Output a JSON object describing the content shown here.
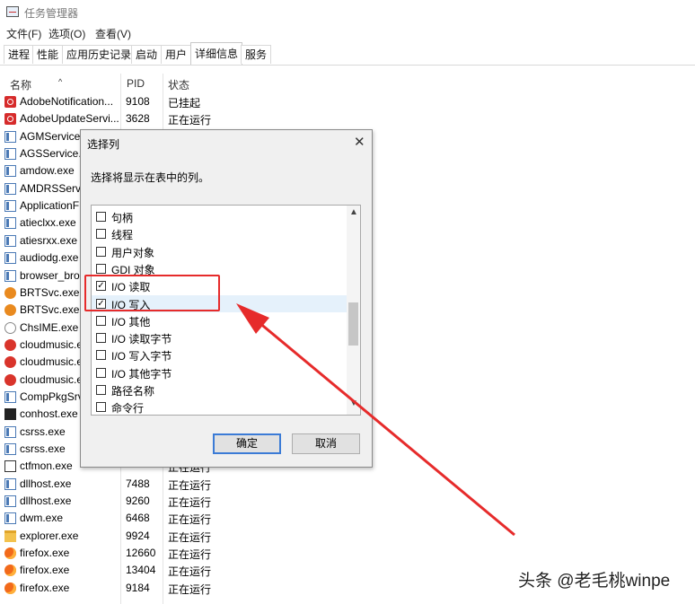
{
  "window": {
    "title": "任务管理器",
    "icon": "task-manager-icon"
  },
  "menu": [
    "文件(F)",
    "选项(O)",
    "查看(V)"
  ],
  "tabs": [
    {
      "label": "进程"
    },
    {
      "label": "性能"
    },
    {
      "label": "应用历史记录"
    },
    {
      "label": "启动"
    },
    {
      "label": "用户"
    },
    {
      "label": "详细信息",
      "active": true
    },
    {
      "label": "服务"
    }
  ],
  "columns": {
    "name": "名称",
    "pid": "PID",
    "status": "状态"
  },
  "rows": [
    {
      "name": "AdobeNotification...",
      "pid": "9108",
      "status": "已挂起",
      "icon": "adobe-icon"
    },
    {
      "name": "AdobeUpdateServi...",
      "pid": "3628",
      "status": "正在运行",
      "icon": "adobe-icon"
    },
    {
      "name": "AGMService",
      "pid": "",
      "status": "",
      "icon": "window-icon"
    },
    {
      "name": "AGSService.e",
      "pid": "",
      "status": "",
      "icon": "window-icon"
    },
    {
      "name": "amdow.exe",
      "pid": "",
      "status": "",
      "icon": "window-icon"
    },
    {
      "name": "AMDRSServ.",
      "pid": "",
      "status": "",
      "icon": "window-icon"
    },
    {
      "name": "ApplicationF",
      "pid": "",
      "status": "",
      "icon": "window-icon"
    },
    {
      "name": "atieclxx.exe",
      "pid": "",
      "status": "",
      "icon": "window-icon"
    },
    {
      "name": "atiesrxx.exe",
      "pid": "",
      "status": "",
      "icon": "window-icon"
    },
    {
      "name": "audiodg.exe",
      "pid": "",
      "status": "",
      "icon": "window-icon"
    },
    {
      "name": "browser_bro",
      "pid": "",
      "status": "",
      "icon": "window-icon"
    },
    {
      "name": "BRTSvc.exe",
      "pid": "",
      "status": "",
      "icon": "gear-icon"
    },
    {
      "name": "BRTSvc.exe",
      "pid": "",
      "status": "",
      "icon": "gear-icon"
    },
    {
      "name": "ChsIME.exe",
      "pid": "",
      "status": "",
      "icon": "ime-icon"
    },
    {
      "name": "cloudmusic.e",
      "pid": "",
      "status": "",
      "icon": "cloudmusic-icon"
    },
    {
      "name": "cloudmusic.e",
      "pid": "",
      "status": "",
      "icon": "cloudmusic-icon"
    },
    {
      "name": "cloudmusic.e",
      "pid": "",
      "status": "",
      "icon": "cloudmusic-icon"
    },
    {
      "name": "CompPkgSrv",
      "pid": "",
      "status": "",
      "icon": "window-icon"
    },
    {
      "name": "conhost.exe",
      "pid": "",
      "status": "",
      "icon": "console-icon"
    },
    {
      "name": "csrss.exe",
      "pid": "",
      "status": "",
      "icon": "window-icon"
    },
    {
      "name": "csrss.exe",
      "pid": "",
      "status": "",
      "icon": "window-icon"
    },
    {
      "name": "ctfmon.exe",
      "pid": "",
      "status": "正在运行",
      "icon": "pen-icon"
    },
    {
      "name": "dllhost.exe",
      "pid": "7488",
      "status": "正在运行",
      "icon": "window-icon"
    },
    {
      "name": "dllhost.exe",
      "pid": "9260",
      "status": "正在运行",
      "icon": "window-icon"
    },
    {
      "name": "dwm.exe",
      "pid": "6468",
      "status": "正在运行",
      "icon": "window-icon"
    },
    {
      "name": "explorer.exe",
      "pid": "9924",
      "status": "正在运行",
      "icon": "folder-icon"
    },
    {
      "name": "firefox.exe",
      "pid": "12660",
      "status": "正在运行",
      "icon": "firefox-icon"
    },
    {
      "name": "firefox.exe",
      "pid": "13404",
      "status": "正在运行",
      "icon": "firefox-icon"
    },
    {
      "name": "firefox.exe",
      "pid": "9184",
      "status": "正在运行",
      "icon": "firefox-icon"
    }
  ],
  "dialog": {
    "title": "选择列",
    "description": "选择将显示在表中的列。",
    "options": [
      {
        "label": "句柄",
        "checked": false
      },
      {
        "label": "线程",
        "checked": false
      },
      {
        "label": "用户对象",
        "checked": false
      },
      {
        "label": "GDI 对象",
        "checked": false
      },
      {
        "label": "I/O 读取",
        "checked": true
      },
      {
        "label": "I/O 写入",
        "checked": true,
        "selected": true
      },
      {
        "label": "I/O 其他",
        "checked": false
      },
      {
        "label": "I/O 读取字节",
        "checked": false
      },
      {
        "label": "I/O 写入字节",
        "checked": false
      },
      {
        "label": "I/O 其他字节",
        "checked": false
      },
      {
        "label": "路径名称",
        "checked": false
      },
      {
        "label": "命令行",
        "checked": false
      }
    ],
    "ok": "确定",
    "cancel": "取消"
  },
  "annotation": {
    "color": "#e62b2b"
  },
  "watermark": "头条 @老毛桃winpe"
}
